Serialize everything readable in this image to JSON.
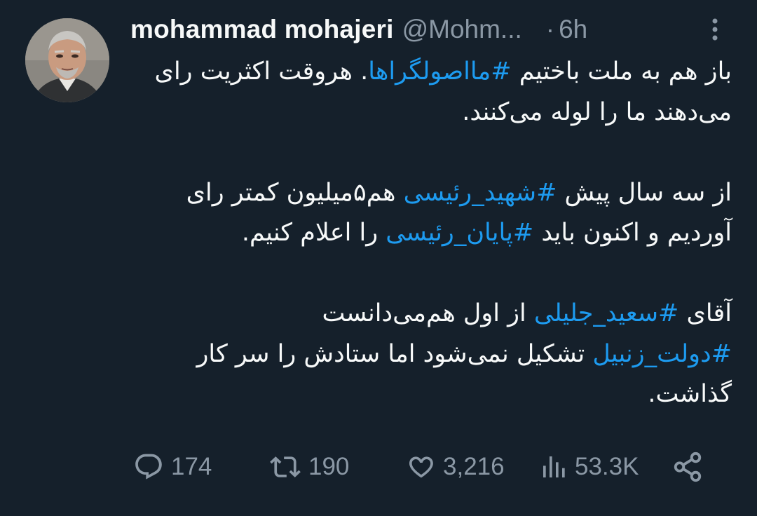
{
  "tweet": {
    "author": {
      "display_name": "mohammad mohajeri",
      "handle": "@Mohm...",
      "avatar_icon": "profile-photo"
    },
    "separator": "·",
    "time": "6h",
    "more_icon": "vertical-ellipsis-icon",
    "body": {
      "p1": {
        "line1_a": "باز هم به ملت باختیم ",
        "hashtag1": "#مااصولگراها",
        "line1_b": ". هروقت اکثریت رای می‌دهند ما را لوله می‌کنند."
      },
      "p2": {
        "a": "از سه سال پیش ",
        "hashtag1": "#شهید_رئیسی",
        "b": " هم۵میلیون کمتر رای آوردیم و اکنون باید ",
        "hashtag2": "#پایان_رئیسی",
        "c": " را اعلام کنیم."
      },
      "p3": {
        "a": "آقای ",
        "hashtag1": "#سعید_جلیلی",
        "b": " از اول هم‌می‌دانست",
        "hashtag2": "#دولت_زنبیل",
        "c": " تشکیل نمی‌شود اما ستادش را سر کار گذاشت."
      }
    },
    "actions": {
      "replies": "174",
      "retweets": "190",
      "likes": "3,216",
      "views": "53.3K"
    },
    "colors": {
      "background": "#15202b",
      "text": "#f7f9f9",
      "secondary": "#8b98a5",
      "accent": "#1d9bf0"
    }
  }
}
